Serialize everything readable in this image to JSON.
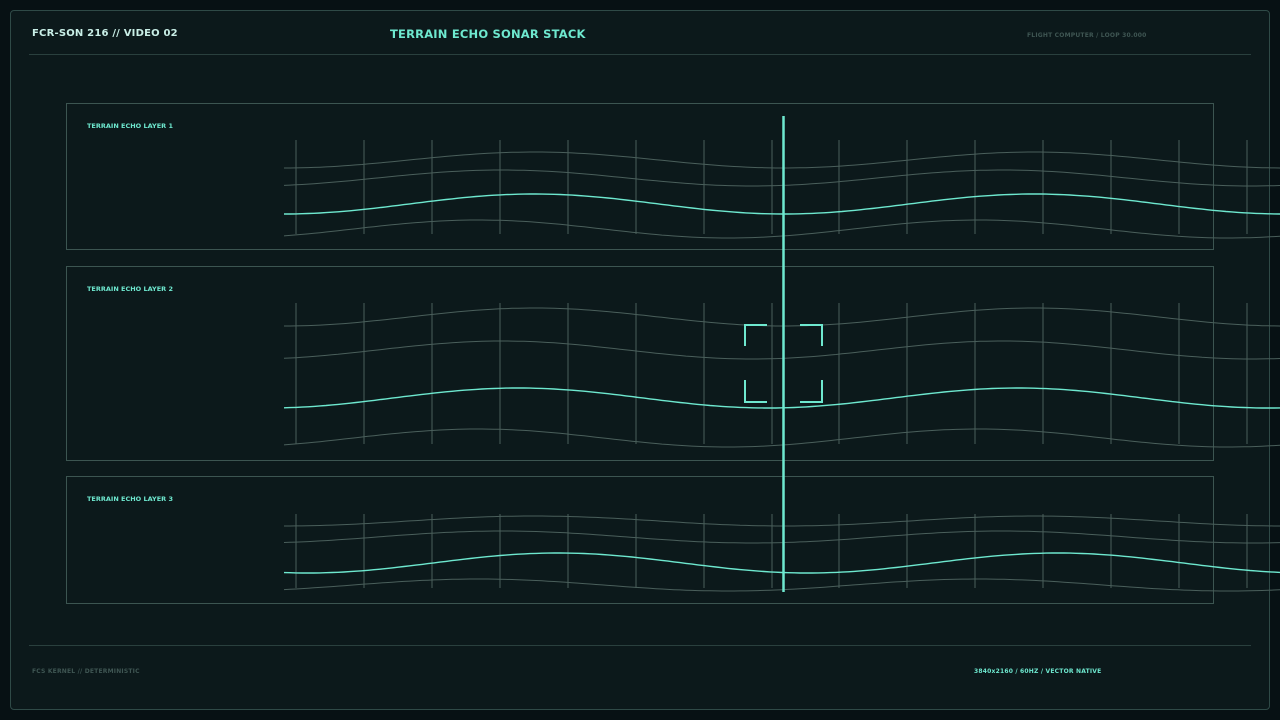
{
  "header": {
    "left_label": "FCR-SON 216 // VIDEO 02",
    "title": "TERRAIN ECHO SONAR STACK",
    "right_label": "FLIGHT COMPUTER / LOOP 30.000"
  },
  "footer": {
    "left_label": "FCS KERNEL // DETERMINISTIC",
    "right_label": "3840x2160 / 60HZ / VECTOR NATIVE"
  },
  "layers": [
    {
      "label": "TERRAIN ECHO LAYER 1"
    },
    {
      "label": "TERRAIN ECHO LAYER 2"
    },
    {
      "label": "TERRAIN ECHO LAYER 3"
    }
  ],
  "colors": {
    "background": "#071114",
    "panel": "#0c191b",
    "border": "#3c5551",
    "accent": "#6ee8cf",
    "grid": "#4a5f5b"
  },
  "icons": {
    "scan_line": "vertical-scan-line",
    "target_reticle": "target-reticle-icon"
  }
}
